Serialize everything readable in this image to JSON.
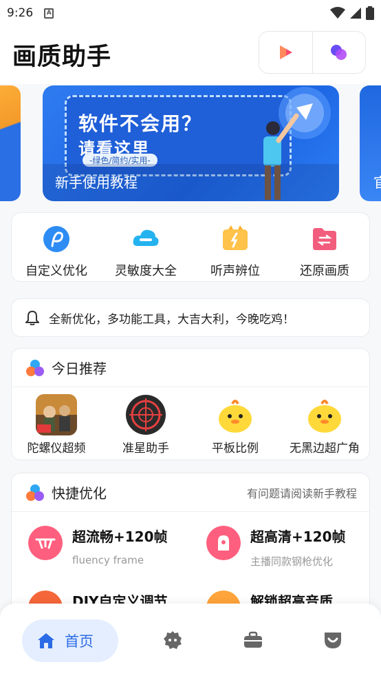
{
  "status_bar": {
    "time": "9:26",
    "app_indicator": "A"
  },
  "header": {
    "title": "画质助手",
    "btn_video_icon": "play-icon",
    "btn_link_icon": "circles-icon"
  },
  "banner": {
    "headline1": "软件不会用？",
    "headline2": "请看这里",
    "tagline": "-绿色/简约/实用-",
    "caption": "新手使用教程",
    "next_caption": "官"
  },
  "tools": [
    {
      "label": "自定义优化",
      "icon": "p-logo-icon"
    },
    {
      "label": "灵敏度大全",
      "icon": "cloud-icon"
    },
    {
      "label": "听声辨位",
      "icon": "sound-icon"
    },
    {
      "label": "还原画质",
      "icon": "folder-exchange-icon"
    }
  ],
  "notice": {
    "text": "全新优化，多功能工具，大吉大利，今晚吃鸡！"
  },
  "recommend": {
    "title": "今日推荐",
    "items": [
      {
        "label": "陀螺仪超频"
      },
      {
        "label": "准星助手"
      },
      {
        "label": "平板比例"
      },
      {
        "label": "无黑边超广角"
      }
    ]
  },
  "quick": {
    "title": "快捷优化",
    "hint": "有问题请阅读新手教程",
    "items": [
      {
        "title": "超流畅+120帧",
        "sub": "fluency frame"
      },
      {
        "title": "超高清+120帧",
        "sub": "主播同款钢枪优化"
      },
      {
        "title": "DIY自定义调节",
        "sub": ""
      },
      {
        "title": "解锁超高音质",
        "sub": ""
      }
    ]
  },
  "nav": {
    "home_label": "首页"
  },
  "colors": {
    "accent": "#2b6be6",
    "banner_blue": "#1b62e0"
  }
}
